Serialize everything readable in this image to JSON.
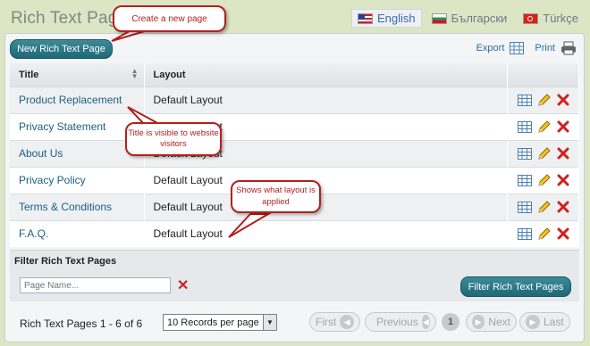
{
  "page": {
    "title": "Rich Text Pages"
  },
  "languages": [
    {
      "label": "English",
      "active": true
    },
    {
      "label": "Български",
      "active": false
    },
    {
      "label": "Türkçe",
      "active": false
    }
  ],
  "toolbar": {
    "new_button": "New Rich Text Page",
    "export_label": "Export",
    "print_label": "Print"
  },
  "table": {
    "headers": {
      "title": "Title",
      "layout": "Layout"
    },
    "rows": [
      {
        "title": "Product Replacement",
        "layout": "Default Layout"
      },
      {
        "title": "Privacy Statement",
        "layout": "Default Layout"
      },
      {
        "title": "About Us",
        "layout": "Default Layout"
      },
      {
        "title": "Privacy Policy",
        "layout": "Default Layout"
      },
      {
        "title": "Terms & Conditions",
        "layout": "Default Layout"
      },
      {
        "title": "F.A.Q.",
        "layout": "Default Layout"
      }
    ]
  },
  "filter": {
    "title": "Filter Rich Text Pages",
    "placeholder": "Page Name...",
    "button": "Filter Rich Text Pages"
  },
  "pager": {
    "info": "Rich Text Pages 1 - 6 of 6",
    "per_page": "10 Records per page",
    "first": "First",
    "previous": "Previous",
    "current": "1",
    "next": "Next",
    "last": "Last"
  },
  "callouts": {
    "create": "Create a new page",
    "title_visible": "Title is visible to website visitors",
    "layout_applied": "Shows what layout is applied"
  },
  "colors": {
    "accent": "#1f6877",
    "callout": "#b32020",
    "link": "#1c5f82"
  }
}
